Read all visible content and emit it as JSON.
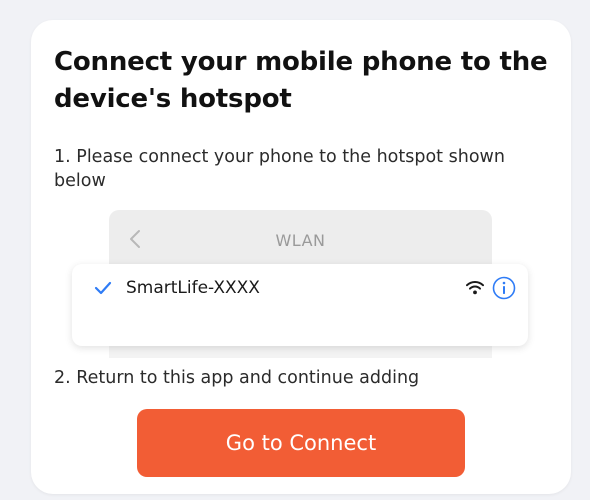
{
  "page": {
    "title": "Connect your mobile phone to the device's hotspot",
    "step1": "1. Please connect your phone to the hotspot shown below",
    "step2": "2. Return to this app and continue adding"
  },
  "wlan_preview": {
    "header_title": "WLAN",
    "network": {
      "ssid": "SmartLife-XXXX",
      "selected_icon": "check-icon",
      "signal_icon": "wifi-signal-icon",
      "info_icon": "info-icon"
    }
  },
  "actions": {
    "connect_label": "Go to Connect"
  },
  "colors": {
    "accent": "#f25d35",
    "info_blue": "#2f7cf6",
    "background": "#f1f2f6",
    "card": "#ffffff"
  }
}
